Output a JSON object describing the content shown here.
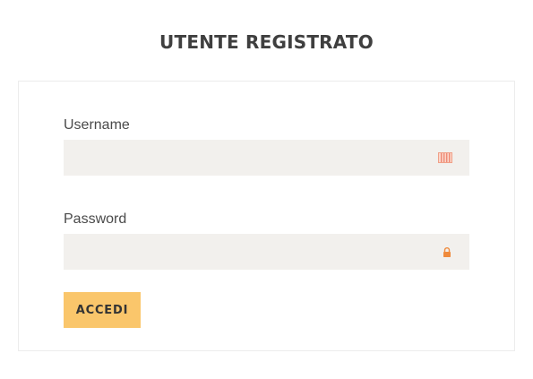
{
  "page": {
    "title": "UTENTE REGISTRATO"
  },
  "form": {
    "username_label": "Username",
    "username_value": "",
    "password_label": "Password",
    "password_value": "",
    "submit_label": "ACCEDI"
  },
  "icons": {
    "username_field_icon": "keyboard-icon",
    "password_field_icon": "lock-icon"
  },
  "colors": {
    "accent": "#fac66b",
    "icon": "#ef8a3c",
    "input_background": "#f2f0ed",
    "title": "#3f3f3f"
  }
}
